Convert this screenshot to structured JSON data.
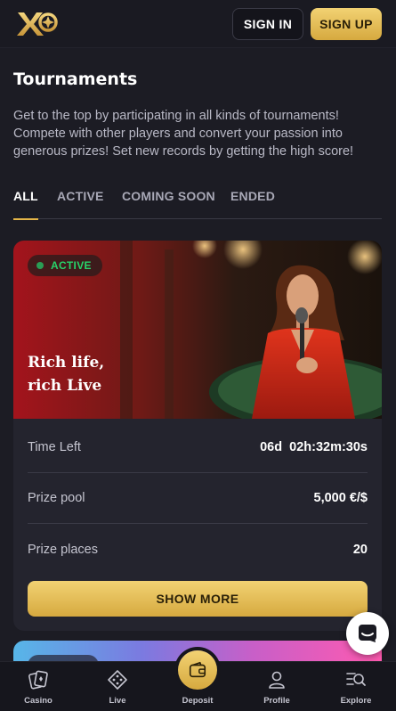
{
  "header": {
    "logo_text": "XO",
    "signin_label": "SIGN IN",
    "signup_label": "SIGN UP"
  },
  "page": {
    "title": "Tournaments",
    "intro": "Get to the top by participating in all kinds of tournaments! Compete with other players and convert your passion into generous prizes! Set new records by getting the high score!"
  },
  "tabs": [
    {
      "label": "ALL",
      "active": true
    },
    {
      "label": "ACTIVE",
      "active": false
    },
    {
      "label": "COMING SOON",
      "active": false
    },
    {
      "label": "ENDED",
      "active": false
    }
  ],
  "tournament": {
    "status": "ACTIVE",
    "title_line1": "Rich life,",
    "title_line2": "rich Live",
    "rows": [
      {
        "label": "Time Left",
        "value": "06d  02h:32m:30s"
      },
      {
        "label": "Prize pool",
        "value": "5,000 €/$"
      },
      {
        "label": "Prize places",
        "value": "20"
      }
    ],
    "button_label": "SHOW MORE"
  },
  "bottom_nav": [
    {
      "label": "Casino",
      "icon": "cards-icon"
    },
    {
      "label": "Live",
      "icon": "dice-diamond-icon"
    },
    {
      "label": "Deposit",
      "icon": "wallet-icon"
    },
    {
      "label": "Profile",
      "icon": "user-icon"
    },
    {
      "label": "Explore",
      "icon": "explore-search-icon"
    }
  ],
  "colors": {
    "background": "#1c1c24",
    "card": "#24242e",
    "accent_gold": "#e3b548",
    "status_green": "#27d36a"
  }
}
